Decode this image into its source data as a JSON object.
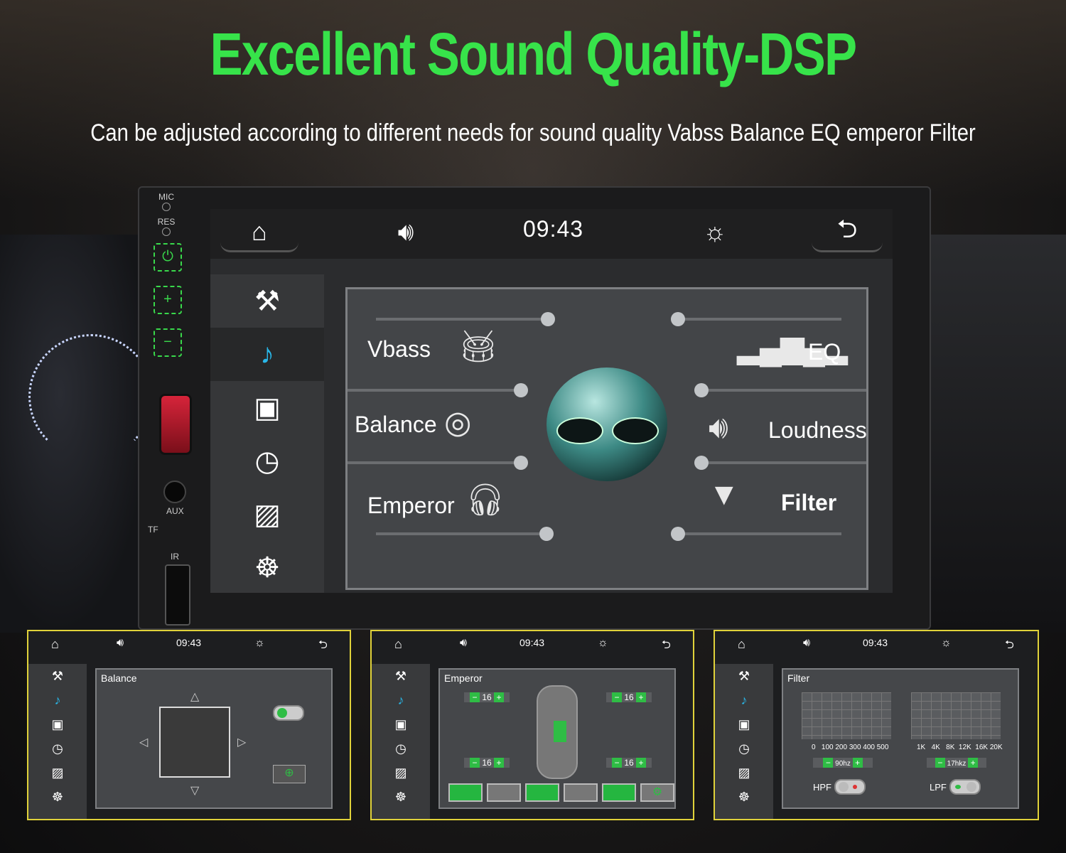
{
  "headline": "Excellent Sound Quality-DSP",
  "subline": "Can be adjusted according to different needs for sound quality Vabss Balance EQ emperor  Filter",
  "unit": {
    "panel_labels": {
      "mic": "MIC",
      "res": "RES",
      "aux": "AUX",
      "tf": "TF",
      "ir": "IR"
    },
    "topbar": {
      "time": "09:43",
      "home_icon": "home-icon",
      "volume_icon": "speaker-icon",
      "brightness_icon": "sun-icon",
      "back_icon": "back-icon"
    },
    "sidebar": [
      {
        "icon": "tools-icon",
        "glyph": "⚒"
      },
      {
        "icon": "music-settings-icon",
        "glyph": "♪",
        "active": true
      },
      {
        "icon": "tv-settings-icon",
        "glyph": "📺"
      },
      {
        "icon": "clock-icon",
        "glyph": "🕓"
      },
      {
        "icon": "image-icon",
        "glyph": "🖼"
      },
      {
        "icon": "steering-wheel-icon",
        "glyph": "☸"
      }
    ],
    "features": {
      "vbass": "Vbass",
      "balance": "Balance",
      "emperor": "Emperor",
      "eq": "EQ",
      "loudness": "Loudness",
      "filter": "Filter"
    }
  },
  "thumbs": [
    {
      "time": "09:43",
      "title": "Balance"
    },
    {
      "time": "09:43",
      "title": "Emperor",
      "values": {
        "fl": "16",
        "fr": "16",
        "rl": "16",
        "rr": "16"
      }
    },
    {
      "time": "09:43",
      "title": "Filter",
      "hpf_ticks": "0   100 200 300 400 500",
      "lpf_ticks": "1K   4K   8K  12K  16K 20K",
      "hpf_value": "90hz",
      "lpf_value": "17hkz",
      "hpf_label": "HPF",
      "lpf_label": "LPF"
    }
  ],
  "colors": {
    "accent_green": "#37e34a",
    "active_blue": "#29b7e8",
    "thumb_border": "#e0d23a"
  }
}
